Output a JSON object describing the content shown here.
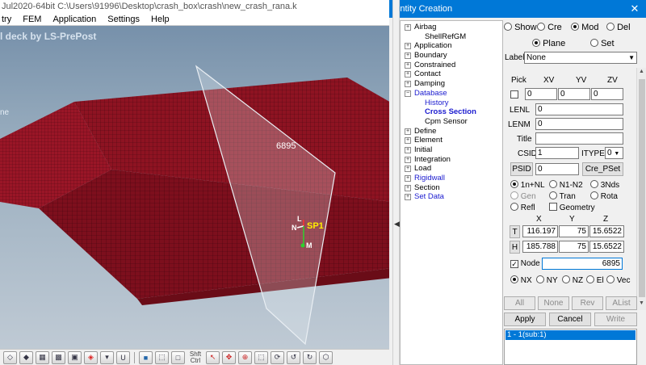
{
  "prepost": {
    "title": "Jul2020-64bit C:\\Users\\91996\\Desktop\\crash_box\\crash\\new_crash_rana.k",
    "menu": [
      "try",
      "FEM",
      "Application",
      "Settings",
      "Help"
    ],
    "banner": "l deck by LS-PrePost",
    "side_label": "ne",
    "node_label": "6895",
    "triad": {
      "l": "L",
      "n": "N",
      "sp": "SP1",
      "m": "M"
    },
    "toolbar_text": {
      "shift": "Shft",
      "ctrl": "Ctrl",
      "u": "U"
    }
  },
  "entity_creation": {
    "title": "Entity Creation",
    "tree": [
      {
        "label": "Airbag",
        "box": "+"
      },
      {
        "label": "ShellRefGM",
        "child": true
      },
      {
        "label": "Application",
        "box": "+"
      },
      {
        "label": "Boundary",
        "box": "+"
      },
      {
        "label": "Constrained",
        "box": "+"
      },
      {
        "label": "Contact",
        "box": "+"
      },
      {
        "label": "Damping",
        "box": "+"
      },
      {
        "label": "Database",
        "box": "-",
        "blue": true
      },
      {
        "label": "History",
        "child": true,
        "blue": true
      },
      {
        "label": "Cross Section",
        "child": true,
        "selected": true
      },
      {
        "label": "Cpm Sensor",
        "child": true
      },
      {
        "label": "Define",
        "box": "+"
      },
      {
        "label": "Element",
        "box": "+"
      },
      {
        "label": "Initial",
        "box": "+"
      },
      {
        "label": "Integration",
        "box": "+"
      },
      {
        "label": "Load",
        "box": "+"
      },
      {
        "label": "Rigidwall",
        "box": "+",
        "blue": true
      },
      {
        "label": "Section",
        "box": "+"
      },
      {
        "label": "Set Data",
        "box": "+",
        "blue": true
      }
    ],
    "modes": [
      "Show",
      "Cre",
      "Mod",
      "Del"
    ],
    "type_options": [
      "Plane",
      "Set"
    ],
    "label_caption": "Label:",
    "label_value": "None",
    "pick_header": {
      "pick": "Pick",
      "xv": "XV",
      "yv": "YV",
      "zv": "ZV"
    },
    "vectors": {
      "xv": "0",
      "yv": "0",
      "zv": "0"
    },
    "lenl": {
      "label": "LENL",
      "value": "0"
    },
    "lenm": {
      "label": "LENM",
      "value": "0"
    },
    "title_field": {
      "label": "Title",
      "value": ""
    },
    "csid": {
      "label": "CSID",
      "value": "1"
    },
    "itype": {
      "label": "ITYPE",
      "value": "0"
    },
    "psid": {
      "label": "PSID",
      "value": "0"
    },
    "cre_pset": "Cre_PSet",
    "method_options": [
      "1n+NL",
      "N1-N2",
      "3Nds",
      "Gen",
      "Tran",
      "Rota",
      "Refl"
    ],
    "geometry_label": "Geometry",
    "coords_header": {
      "x": "X",
      "y": "Y",
      "z": "Z"
    },
    "t_row": {
      "label": "T",
      "x": "116.197",
      "y": "75",
      "z": "15.6522"
    },
    "h_row": {
      "label": "H",
      "x": "185.788",
      "y": "75",
      "z": "15.6522"
    },
    "node": {
      "label": "Node",
      "value": "6895"
    },
    "direction_options": [
      "NX",
      "NY",
      "NZ",
      "El",
      "Vec"
    ],
    "buttons_row1": [
      "All",
      "None",
      "Rev",
      "AList"
    ],
    "buttons_row2": [
      "Apply",
      "Cancel",
      "Write"
    ],
    "list_item": "1 - 1(sub:1)"
  },
  "colors": {
    "accent": "#0078d7",
    "mesh": "#8b1020",
    "tree_link": "#1a1acf"
  }
}
